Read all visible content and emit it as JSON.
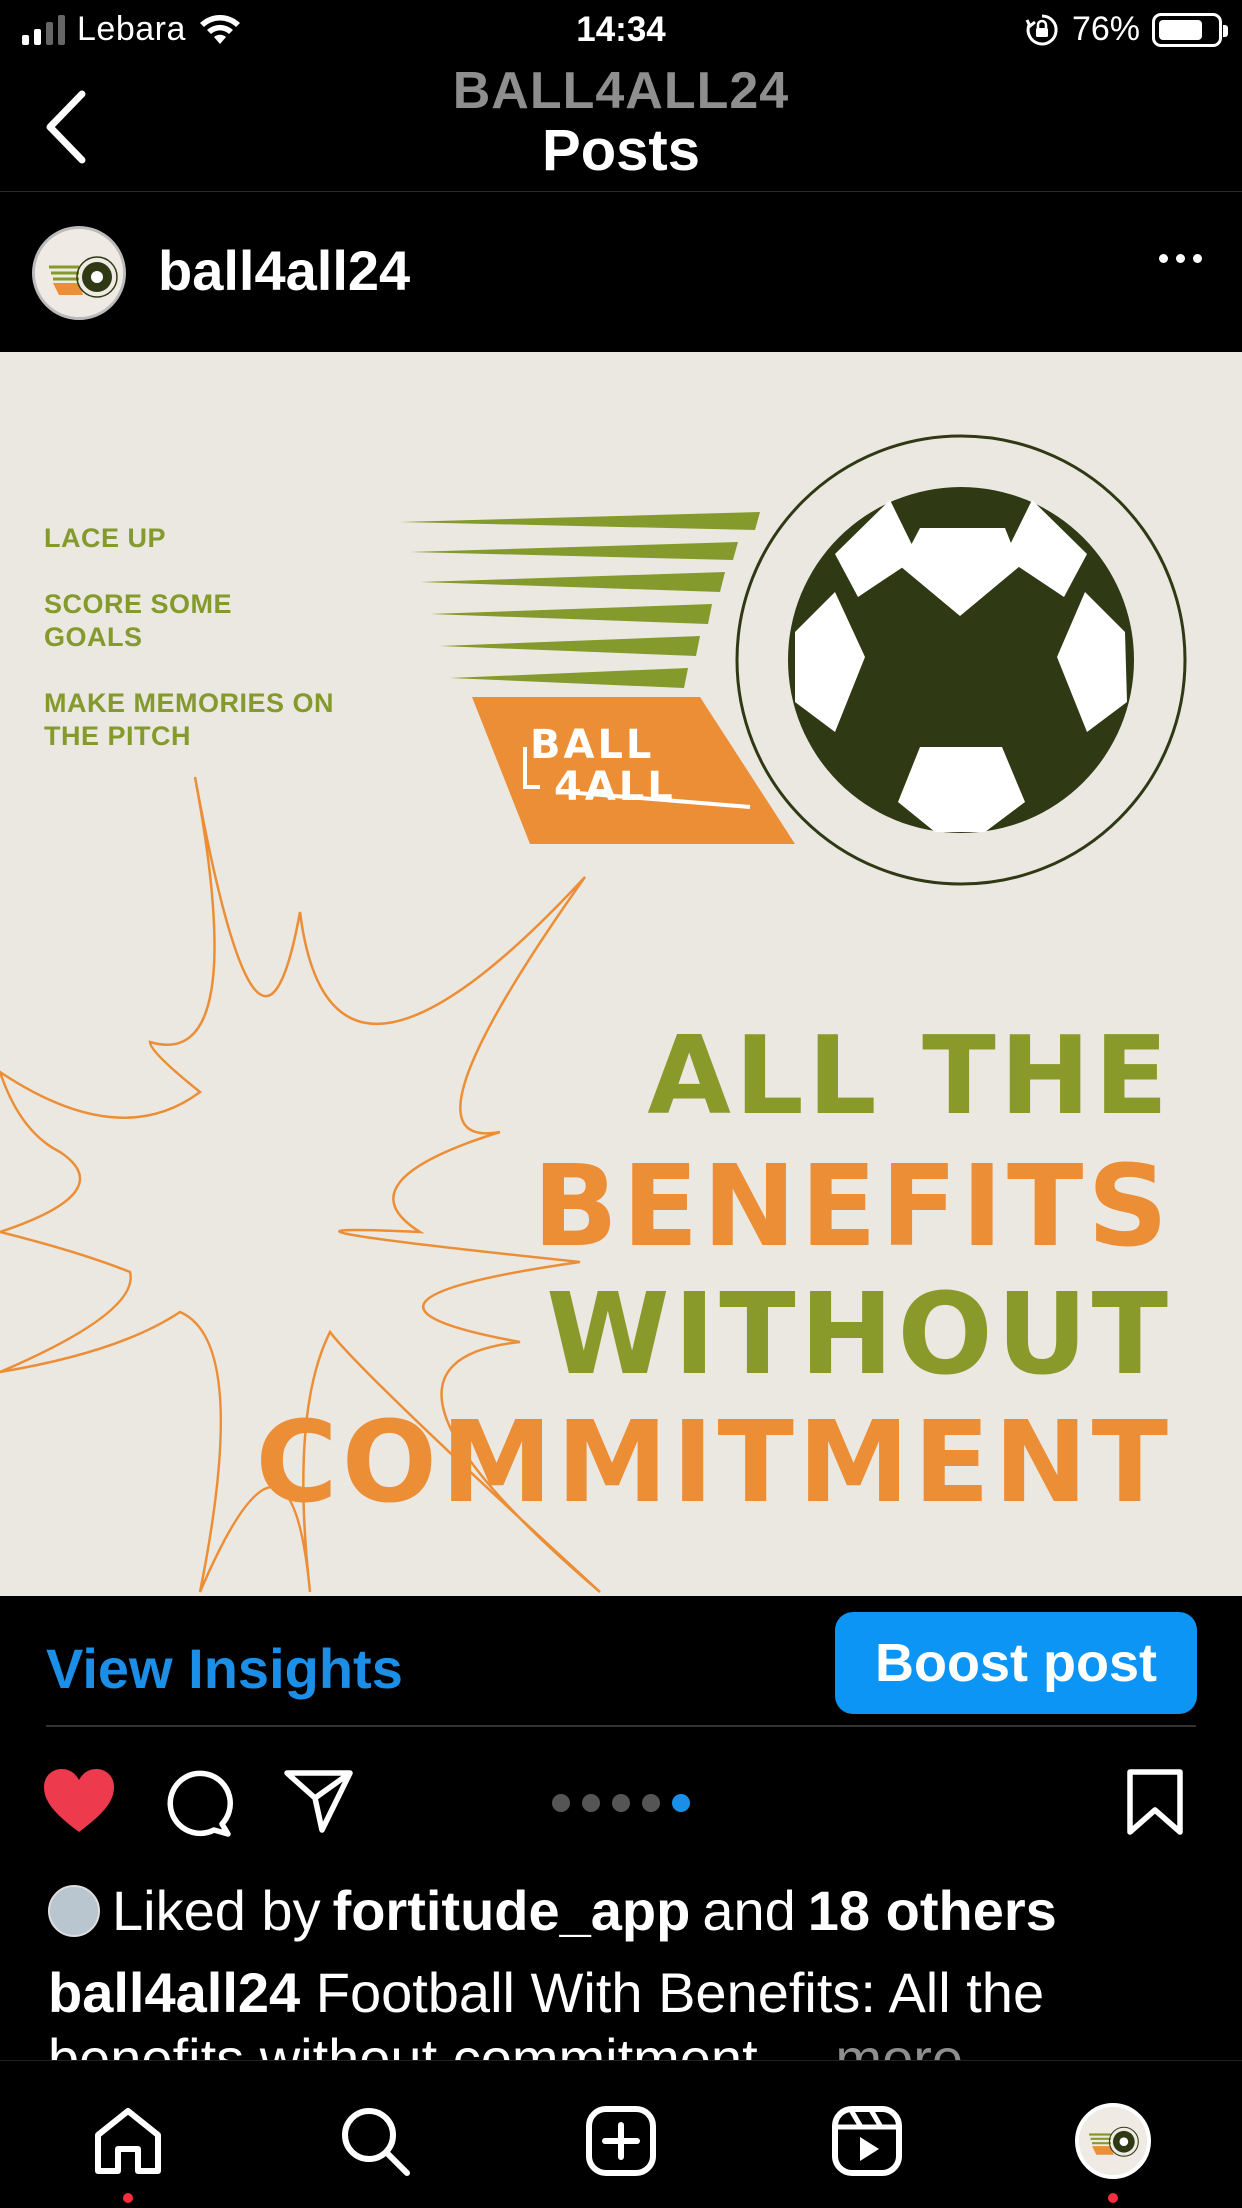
{
  "status_bar": {
    "carrier": "Lebara",
    "time": "14:34",
    "battery_percent": "76%",
    "battery_level": 0.76
  },
  "nav": {
    "account": "BALL4ALL24",
    "title": "Posts"
  },
  "post": {
    "username": "ball4all24",
    "image": {
      "list_items": [
        "LACE UP",
        "SCORE SOME GOALS",
        "MAKE MEMORIES ON THE PITCH"
      ],
      "logo_line1": "BALL",
      "logo_line2": "4ALL",
      "headline_line1": "ALL THE",
      "headline_line2": "BENEFITS",
      "headline_line3": "WITHOUT",
      "headline_line4": "COMMITMENT",
      "colors": {
        "green": "#8a9a2a",
        "orange": "#ec8e35",
        "dark_green": "#2f3a14",
        "background": "#ebe8e2"
      }
    },
    "view_insights_label": "View Insights",
    "boost_label": "Boost post",
    "carousel": {
      "count": 5,
      "active_index": 4
    },
    "liked_by_prefix": "Liked by",
    "liked_by_user": "fortitude_app",
    "liked_by_and": "and",
    "liked_by_others": "18 others",
    "caption_user": "ball4all24",
    "caption_text": "Football With Benefits: All the benefits without commitment",
    "caption_more": "... more"
  },
  "tabbar": {
    "items": [
      "home-icon",
      "search-icon",
      "create-icon",
      "reels-icon",
      "profile-avatar"
    ]
  },
  "accent_color": "#0d95f6",
  "like_color": "#ed3a4c"
}
